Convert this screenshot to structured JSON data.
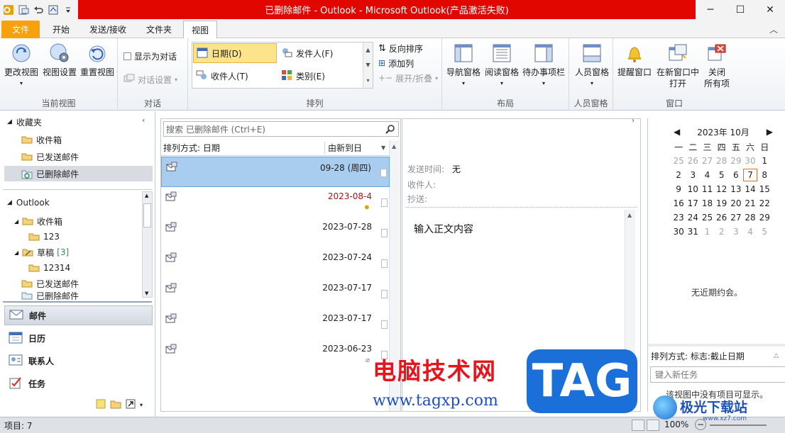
{
  "window": {
    "title": "已删除邮件 - Outlook - Microsoft Outlook(产品激活失败)",
    "minimize": "─",
    "maximize": "☐",
    "close": "✕"
  },
  "tabs": [
    {
      "label": "文件"
    },
    {
      "label": "开始"
    },
    {
      "label": "发送/接收"
    },
    {
      "label": "文件夹"
    },
    {
      "label": "视图"
    }
  ],
  "ribbon": {
    "current_view": {
      "label": "当前视图",
      "change_view": "更改视图",
      "view_settings": "视图设置",
      "reset_view": "重置视图"
    },
    "conversations": {
      "label": "对话",
      "show_as_conversations": "显示为对话",
      "conversation_settings": "对话设置"
    },
    "arrangement": {
      "label": "排列",
      "date": "日期(D)",
      "from": "发件人(F)",
      "to": "收件人(T)",
      "categories": "类别(E)",
      "reverse_sort": "反向排序",
      "add_columns": "添加列",
      "expand_collapse": "展开/折叠"
    },
    "layout": {
      "label": "布局",
      "navigation_pane": "导航窗格",
      "reading_pane": "阅读窗格",
      "todo_bar": "待办事项栏"
    },
    "people_pane": {
      "label": "人员窗格",
      "people_pane": "人员窗格"
    },
    "window": {
      "label": "窗口",
      "reminders": "提醒窗口",
      "open_new_window_1": "在新窗口中",
      "open_new_window_2": "打开",
      "close_all_1": "关闭",
      "close_all_2": "所有项"
    }
  },
  "nav": {
    "favorites": "收藏夹",
    "fav_items": [
      "收件箱",
      "已发送邮件",
      "已删除邮件"
    ],
    "account": "Outlook",
    "inbox": "收件箱",
    "inbox_sub": "123",
    "drafts": "草稿",
    "drafts_count": "[3]",
    "drafts_sub": "12314",
    "sent": "已发送邮件",
    "deleted": "已删除邮件",
    "mail": "邮件",
    "calendar": "日历",
    "contacts": "联系人",
    "tasks": "任务"
  },
  "list": {
    "search_placeholder": "搜索 已删除邮件 (Ctrl+E)",
    "sort_by": "排列方式: 日期",
    "sort_dir": "由新到日",
    "messages": [
      {
        "date": "09-28 (周四)",
        "color": "#1e1e1e"
      },
      {
        "date": "2023-08-4",
        "color": "#a3161b"
      },
      {
        "date": "2023-07-28",
        "color": "#1e1e1e"
      },
      {
        "date": "2023-07-24",
        "color": "#1e1e1e"
      },
      {
        "date": "2023-07-17",
        "color": "#1e1e1e"
      },
      {
        "date": "2023-07-17",
        "color": "#1e1e1e"
      },
      {
        "date": "2023-06-23",
        "color": "#1e1e1e"
      }
    ]
  },
  "reading": {
    "sent_label": "发送时间:",
    "sent_value": "无",
    "to_label": "收件人:",
    "cc_label": "抄送:",
    "body": "输入正文内容"
  },
  "calendar": {
    "month": "2023年 10月",
    "weekdays": [
      "一",
      "二",
      "三",
      "四",
      "五",
      "六",
      "日"
    ],
    "days": [
      [
        "25",
        "26",
        "27",
        "28",
        "29",
        "30",
        "1"
      ],
      [
        "2",
        "3",
        "4",
        "5",
        "6",
        "7",
        "8"
      ],
      [
        "9",
        "10",
        "11",
        "12",
        "13",
        "14",
        "15"
      ],
      [
        "16",
        "17",
        "18",
        "19",
        "20",
        "21",
        "22"
      ],
      [
        "23",
        "24",
        "25",
        "26",
        "27",
        "28",
        "29"
      ],
      [
        "30",
        "31",
        "1",
        "2",
        "3",
        "4",
        "5"
      ]
    ],
    "today": "7",
    "no_appointments": "无近期约会。"
  },
  "tasks": {
    "sort": "排列方式: 标志:截止日期",
    "new_task_placeholder": "键入新任务",
    "empty": "该视图中没有项目可显示。"
  },
  "status": {
    "items": "项目: 7",
    "zoom": "100%",
    "zoom_minus": "−"
  },
  "watermark": {
    "cn": "电脑技术网",
    "url": "www.tagxp.com",
    "tag": "TAG",
    "jg": "极光下载站",
    "jg_url": "www.xz7.com"
  },
  "colors": {
    "title_red": "#e10600",
    "file_tab": "#f7a10c",
    "selection": "#a9cdef",
    "arrange_selected": "#fde38a"
  }
}
